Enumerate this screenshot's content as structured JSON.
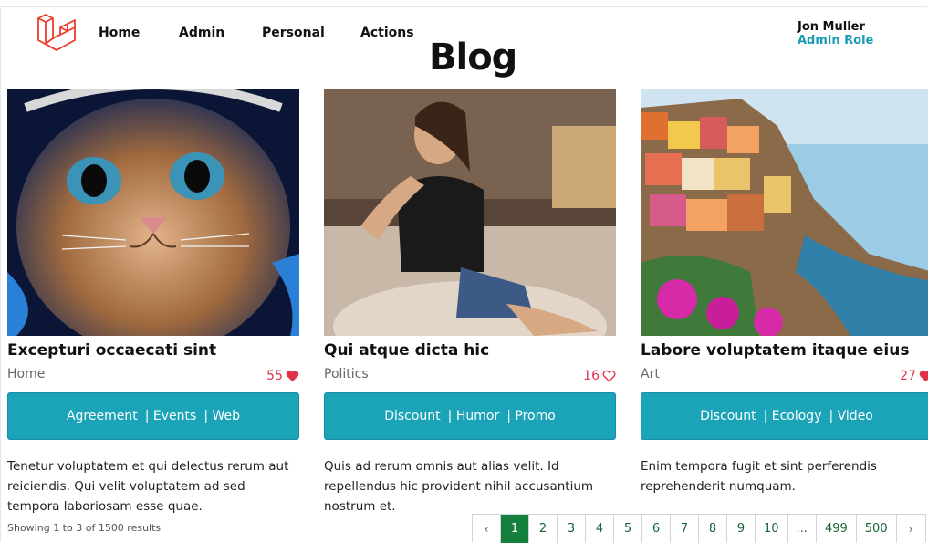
{
  "nav": {
    "items": [
      {
        "label": "Home"
      },
      {
        "label": "Admin"
      },
      {
        "label": "Personal"
      },
      {
        "label": "Actions"
      }
    ]
  },
  "user": {
    "name": "Jon Muller",
    "role": "Admin Role"
  },
  "page": {
    "title": "Blog"
  },
  "colors": {
    "accent": "#1ba3b8",
    "like": "#e0334b",
    "pager_active": "#15803d",
    "logo": "#ef3b2d"
  },
  "posts": [
    {
      "title": "Excepturi occaecati sint",
      "category": "Home",
      "likes": "55",
      "liked": true,
      "tags": [
        "Agreement",
        "| Events",
        "| Web"
      ],
      "description": "Tenetur voluptatem et qui delectus rerum aut reiciendis. Qui velit voluptatem ad sed tempora laboriosam esse quae."
    },
    {
      "title": "Qui atque dicta hic",
      "category": "Politics",
      "likes": "16",
      "liked": false,
      "tags": [
        "Discount",
        "| Humor",
        "| Promo"
      ],
      "description": "Quis ad rerum omnis aut alias velit. Id repellendus hic provident nihil accusantium nostrum et."
    },
    {
      "title": "Labore voluptatem itaque eius",
      "category": "Art",
      "likes": "27",
      "liked": true,
      "tags": [
        "Discount",
        "| Ecology",
        "| Video"
      ],
      "description": "Enim tempora fugit et sint perferendis reprehenderit numquam."
    }
  ],
  "pagination": {
    "summary": "Showing 1 to 3 of 1500 results",
    "prev": "‹",
    "next": "›",
    "pages": [
      "1",
      "2",
      "3",
      "4",
      "5",
      "6",
      "7",
      "8",
      "9",
      "10",
      "...",
      "499",
      "500"
    ],
    "current": "1"
  }
}
